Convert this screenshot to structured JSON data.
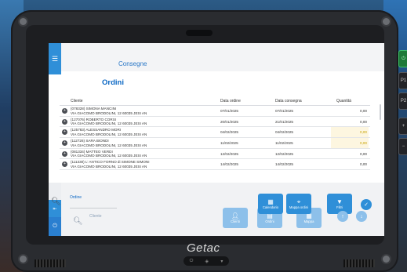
{
  "app": {
    "title": "Consegne",
    "page_title": "Ordini"
  },
  "table": {
    "headers": [
      "Cliente",
      "Data ordine",
      "Data consegna",
      "Quantità"
    ],
    "rows": [
      {
        "line1": "(078328) SIMONA MANCINI",
        "line2": "VIA GIACOMO BRODOLINI, 12 60035 JESI AN",
        "order_date": "07/01/2025",
        "delivery_date": "07/01/2025",
        "quantity": "0,00",
        "highlight": false
      },
      {
        "line1": "(127076) ROBERTO CORSI",
        "line2": "VIA GIACOMO BRODOLINI, 12 60035 JESI AN",
        "order_date": "20/01/2025",
        "delivery_date": "21/01/2025",
        "quantity": "0,00",
        "highlight": false
      },
      {
        "line1": "(125783) ALESSANDRO MORI",
        "line2": "VIA GIACOMO BRODOLINI, 12 60035 JESI AN",
        "order_date": "04/02/2025",
        "delivery_date": "04/02/2025",
        "quantity": "0,00",
        "highlight": true
      },
      {
        "line1": "(112726) SARA BIONDI",
        "line2": "VIA GIACOMO BRODOLINI, 12 60035 JESI AN",
        "order_date": "11/02/2025",
        "delivery_date": "11/02/2025",
        "quantity": "0,00",
        "highlight": true
      },
      {
        "line1": "(081334) MATTEO VERDI",
        "line2": "VIA GIACOMO BRODOLINI, 12 60035 JESI AN",
        "order_date": "12/02/2025",
        "delivery_date": "12/02/2025",
        "quantity": "0,00",
        "highlight": false
      },
      {
        "line1": "(111330) L' ANTICO FORNO di SIMONE SIMONI",
        "line2": "VIA GIACOMO BRODOLINI, 12 60035 JESI AN",
        "order_date": "14/02/2025",
        "delivery_date": "14/02/2025",
        "quantity": "0,00",
        "highlight": false
      }
    ]
  },
  "filters": {
    "order_label": "Ordine",
    "client_label": "Cliente"
  },
  "toolbar": {
    "calendar": "Calendario",
    "map": "Mappa ordini",
    "filter": "Filtri",
    "clients": "Clienti",
    "orders": "Ordini",
    "map_bg": "Mappa"
  },
  "device": {
    "brand": "Getac",
    "side_buttons": [
      "P1",
      "P2",
      "+",
      "−"
    ]
  },
  "colors": {
    "accent": "#2f8fd8",
    "title": "#0b67c4",
    "highlight_bg": "#fdf6e0",
    "highlight_text": "#c7a200"
  }
}
